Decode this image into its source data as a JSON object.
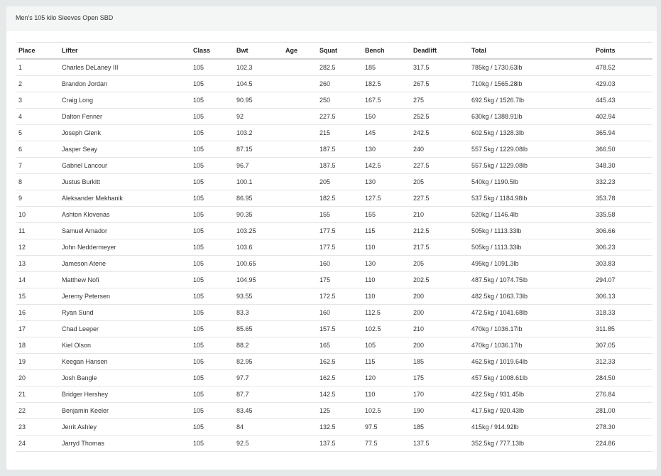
{
  "header": {
    "title": "Men's 105 kilo Sleeves Open SBD"
  },
  "table": {
    "columns": [
      "Place",
      "Lifter",
      "Class",
      "Bwt",
      "Age",
      "Squat",
      "Bench",
      "Deadlift",
      "Total",
      "Points"
    ],
    "rows": [
      [
        "1",
        "Charles DeLaney III",
        "105",
        "102.3",
        "",
        "282.5",
        "185",
        "317.5",
        "785kg / 1730.63lb",
        "478.52"
      ],
      [
        "2",
        "Brandon Jordan",
        "105",
        "104.5",
        "",
        "260",
        "182.5",
        "267.5",
        "710kg / 1565.28lb",
        "429.03"
      ],
      [
        "3",
        "Craig Long",
        "105",
        "90.95",
        "",
        "250",
        "167.5",
        "275",
        "692.5kg / 1526.7lb",
        "445.43"
      ],
      [
        "4",
        "Dalton Fenner",
        "105",
        "92",
        "",
        "227.5",
        "150",
        "252.5",
        "630kg / 1388.91lb",
        "402.94"
      ],
      [
        "5",
        "Joseph Glenk",
        "105",
        "103.2",
        "",
        "215",
        "145",
        "242.5",
        "602.5kg / 1328.3lb",
        "365.94"
      ],
      [
        "6",
        "Jasper Seay",
        "105",
        "87.15",
        "",
        "187.5",
        "130",
        "240",
        "557.5kg / 1229.08lb",
        "366.50"
      ],
      [
        "7",
        "Gabriel Lancour",
        "105",
        "96.7",
        "",
        "187.5",
        "142.5",
        "227.5",
        "557.5kg / 1229.08lb",
        "348.30"
      ],
      [
        "8",
        "Justus Burkitt",
        "105",
        "100.1",
        "",
        "205",
        "130",
        "205",
        "540kg / 1190.5lb",
        "332.23"
      ],
      [
        "9",
        "Aleksander Mekhanik",
        "105",
        "86.95",
        "",
        "182.5",
        "127.5",
        "227.5",
        "537.5kg / 1184.98lb",
        "353.78"
      ],
      [
        "10",
        "Ashton Klovenas",
        "105",
        "90.35",
        "",
        "155",
        "155",
        "210",
        "520kg / 1146.4lb",
        "335.58"
      ],
      [
        "11",
        "Samuel Amador",
        "105",
        "103.25",
        "",
        "177.5",
        "115",
        "212.5",
        "505kg / 1113.33lb",
        "306.66"
      ],
      [
        "12",
        "John Neddermeyer",
        "105",
        "103.6",
        "",
        "177.5",
        "110",
        "217.5",
        "505kg / 1113.33lb",
        "306.23"
      ],
      [
        "13",
        "Jameson Atene",
        "105",
        "100.65",
        "",
        "160",
        "130",
        "205",
        "495kg / 1091.3lb",
        "303.83"
      ],
      [
        "14",
        "Matthew Nofi",
        "105",
        "104.95",
        "",
        "175",
        "110",
        "202.5",
        "487.5kg / 1074.75lb",
        "294.07"
      ],
      [
        "15",
        "Jeremy Petersen",
        "105",
        "93.55",
        "",
        "172.5",
        "110",
        "200",
        "482.5kg / 1063.73lb",
        "306.13"
      ],
      [
        "16",
        "Ryan Sund",
        "105",
        "83.3",
        "",
        "160",
        "112.5",
        "200",
        "472.5kg / 1041.68lb",
        "318.33"
      ],
      [
        "17",
        "Chad Leeper",
        "105",
        "85.65",
        "",
        "157.5",
        "102.5",
        "210",
        "470kg / 1036.17lb",
        "311.85"
      ],
      [
        "18",
        "Kiel Olson",
        "105",
        "88.2",
        "",
        "165",
        "105",
        "200",
        "470kg / 1036.17lb",
        "307.05"
      ],
      [
        "19",
        "Keegan Hansen",
        "105",
        "82.95",
        "",
        "162.5",
        "115",
        "185",
        "462.5kg / 1019.64lb",
        "312.33"
      ],
      [
        "20",
        "Josh Bangle",
        "105",
        "97.7",
        "",
        "162.5",
        "120",
        "175",
        "457.5kg / 1008.61lb",
        "284.50"
      ],
      [
        "21",
        "Bridger Hershey",
        "105",
        "87.7",
        "",
        "142.5",
        "110",
        "170",
        "422.5kg / 931.45lb",
        "276.84"
      ],
      [
        "22",
        "Benjamin Keeler",
        "105",
        "83.45",
        "",
        "125",
        "102.5",
        "190",
        "417.5kg / 920.43lb",
        "281.00"
      ],
      [
        "23",
        "Jerrit Ashley",
        "105",
        "84",
        "",
        "132.5",
        "97.5",
        "185",
        "415kg / 914.92lb",
        "278.30"
      ],
      [
        "24",
        "Jarryd Thomas",
        "105",
        "92.5",
        "",
        "137.5",
        "77.5",
        "137.5",
        "352.5kg / 777.13lb",
        "224.86"
      ]
    ]
  }
}
